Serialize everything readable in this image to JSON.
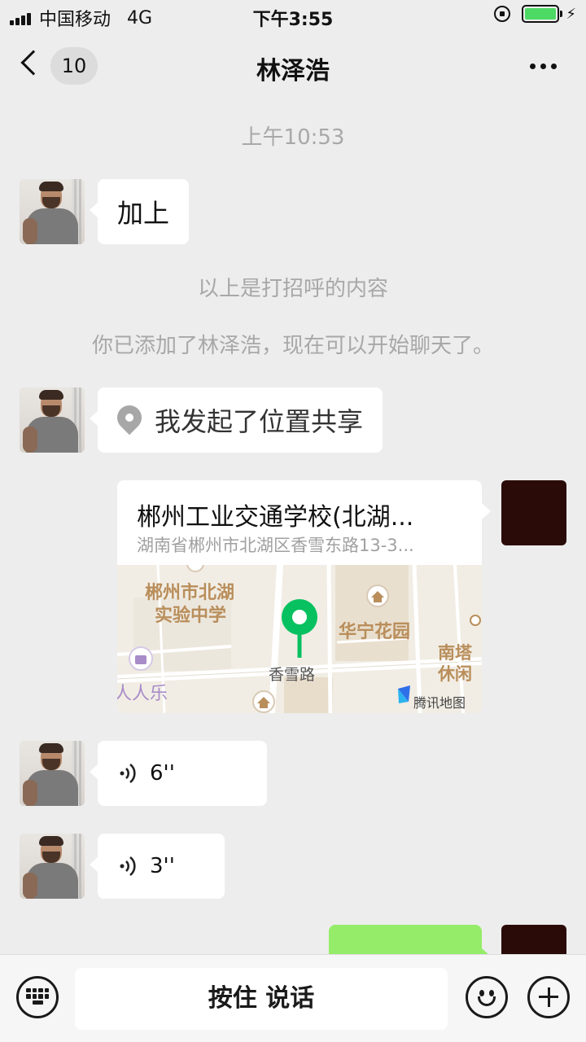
{
  "status_bar": {
    "carrier": "中国移动",
    "network": "4G",
    "time": "下午3:55",
    "battery_color": "#4cd964"
  },
  "nav": {
    "unread_count": "10",
    "title": "林泽浩"
  },
  "chat": {
    "timestamp": "上午10:53",
    "msg_greeting": "加上",
    "sys_greeting_note": "以上是打招呼的内容",
    "sys_added_note": "你已添加了林泽浩，现在可以开始聊天了。",
    "msg_location_share": "我发起了位置共享",
    "location_card": {
      "name": "郴州工业交通学校(北湖...",
      "address": "湖南省郴州市北湖区香雪东路13-3...",
      "map": {
        "poi_school_line1": "郴州市北湖",
        "poi_school_line2": "实验中学",
        "poi_garden": "华宁花园",
        "poi_south_line1": "南塔",
        "poi_south_line2": "休闲",
        "poi_road": "香雪路",
        "poi_left": "人人乐",
        "attribution": "腾讯地图",
        "pin_color": "#07c160"
      }
    },
    "voice_1_duration": "6''",
    "voice_2_duration": "3''",
    "sent_bubble_color": "#95ec69"
  },
  "input_bar": {
    "hold_to_talk": "按住 说话"
  }
}
